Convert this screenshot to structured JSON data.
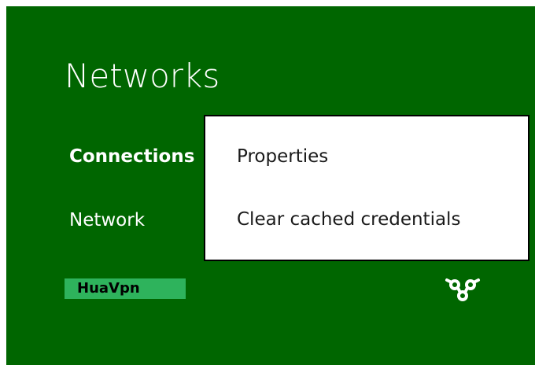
{
  "page": {
    "title": "Networks",
    "section_label": "Connections",
    "network_label": "Network"
  },
  "vpn": {
    "name": "HuaVpn",
    "status_icon": "vpn-connection-icon"
  },
  "context_menu": {
    "items": [
      {
        "label": "Properties"
      },
      {
        "label": "Clear cached credentials"
      }
    ]
  },
  "colors": {
    "background": "#006600",
    "accent_highlight": "#2eb35c",
    "menu_bg": "#ffffff",
    "menu_text": "#1a1a1a"
  }
}
